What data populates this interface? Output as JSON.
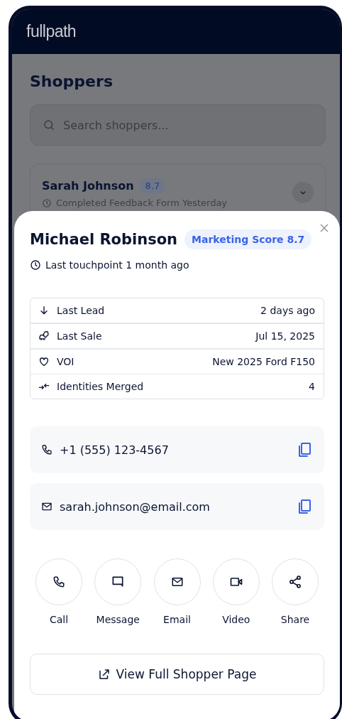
{
  "app": {
    "logo": "fullpath"
  },
  "page": {
    "title": "Shoppers",
    "search": {
      "placeholder": "Search shoppers..."
    },
    "shoppers": [
      {
        "name": "Sarah Johnson",
        "score": "8.7",
        "activity": "Completed Feedback Form Yesterday"
      }
    ]
  },
  "sheet": {
    "name": "Michael Robinson",
    "badge": "Marketing Score 8.7",
    "touchpoint": "Last touchpoint 1 month ago",
    "details": [
      {
        "kind": "lead",
        "label": "Last Lead",
        "value": "2 days ago"
      },
      {
        "kind": "sale",
        "label": "Last Sale",
        "value": "Jul 15, 2025"
      },
      {
        "kind": "voi",
        "label": "VOI",
        "value": "New 2025 Ford F150"
      },
      {
        "kind": "merged",
        "label": "Identities Merged",
        "value": "4"
      }
    ],
    "contacts": [
      {
        "kind": "phone",
        "value": "+1 (555) 123-4567"
      },
      {
        "kind": "email",
        "value": "sarah.johnson@email.com"
      }
    ],
    "actions": [
      {
        "kind": "call",
        "label": "Call"
      },
      {
        "kind": "message",
        "label": "Message"
      },
      {
        "kind": "email",
        "label": "Email"
      },
      {
        "kind": "video",
        "label": "Video"
      },
      {
        "kind": "share",
        "label": "Share"
      }
    ],
    "primary_button": "View Full Shopper Page"
  }
}
